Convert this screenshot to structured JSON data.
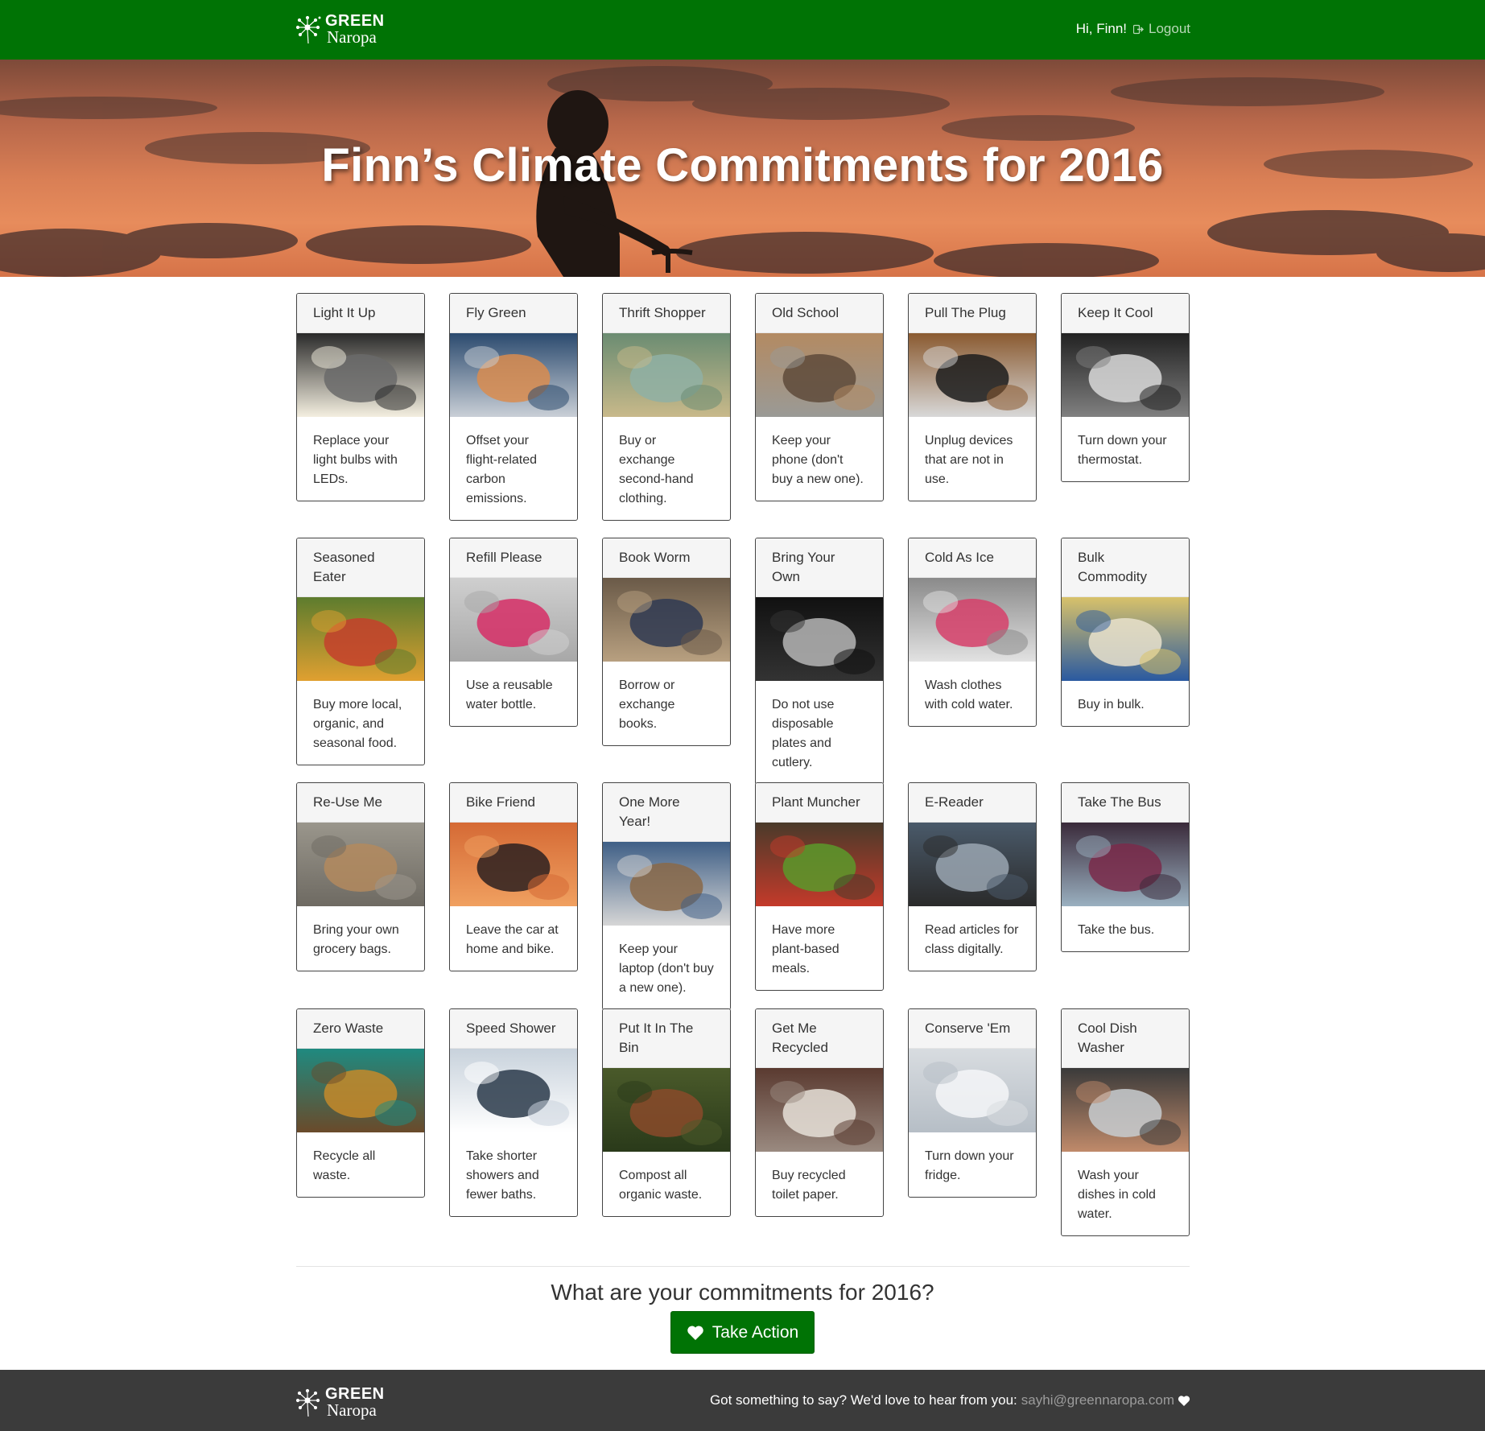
{
  "navbar": {
    "logo_top": "GREEN",
    "logo_bottom": "Naropa",
    "greeting": "Hi, Finn!",
    "logout": "Logout"
  },
  "hero": {
    "title": "Finn’s Climate Commitments for 2016"
  },
  "cards": [
    {
      "title": "Light It Up",
      "text": "Replace your light bulbs with LEDs.",
      "image": "led-bulbs"
    },
    {
      "title": "Fly Green",
      "text": "Offset your flight-related carbon emissions.",
      "image": "airplane-wing"
    },
    {
      "title": "Thrift Shopper",
      "text": "Buy or exchange second-hand clothing.",
      "image": "second-hand-sign"
    },
    {
      "title": "Old School",
      "text": "Keep your phone (don't buy a new one).",
      "image": "old-phone"
    },
    {
      "title": "Pull The Plug",
      "text": "Unplug devices that are not in use.",
      "image": "plug"
    },
    {
      "title": "Keep It Cool",
      "text": "Turn down your thermostat.",
      "image": "radiator"
    },
    {
      "title": "Seasoned Eater",
      "text": "Buy more local, organic, and seasonal food.",
      "image": "market"
    },
    {
      "title": "Refill Please",
      "text": "Use a reusable water bottle.",
      "image": "water-bottle"
    },
    {
      "title": "Book Worm",
      "text": "Borrow or exchange books.",
      "image": "bookstore"
    },
    {
      "title": "Bring Your Own",
      "text": "Do not use disposable plates and cutlery.",
      "image": "fork"
    },
    {
      "title": "Cold As Ice",
      "text": "Wash clothes with cold water.",
      "image": "washing-machine"
    },
    {
      "title": "Bulk Commodity",
      "text": "Buy in bulk.",
      "image": "rice-sacks"
    },
    {
      "title": "Re-Use Me",
      "text": "Bring your own grocery bags.",
      "image": "paper-bag"
    },
    {
      "title": "Bike Friend",
      "text": "Leave the car at home and bike.",
      "image": "cyclist"
    },
    {
      "title": "One More Year!",
      "text": "Keep your laptop (don't buy a new one).",
      "image": "laptop"
    },
    {
      "title": "Plant Muncher",
      "text": "Have more plant-based meals.",
      "image": "vegetable-basket"
    },
    {
      "title": "E-Reader",
      "text": "Read articles for class digitally.",
      "image": "e-reader"
    },
    {
      "title": "Take The Bus",
      "text": "Take the bus.",
      "image": "bus-interior"
    },
    {
      "title": "Zero Waste",
      "text": "Recycle all waste.",
      "image": "recycle-bag"
    },
    {
      "title": "Speed Shower",
      "text": "Take shorter showers and fewer baths.",
      "image": "shower-head"
    },
    {
      "title": "Put It In The Bin",
      "text": "Compost all organic waste.",
      "image": "compost"
    },
    {
      "title": "Get Me Recycled",
      "text": "Buy recycled toilet paper.",
      "image": "toilet-paper"
    },
    {
      "title": "Conserve 'Em",
      "text": "Turn down your fridge.",
      "image": "ice"
    },
    {
      "title": "Cool Dish Washer",
      "text": "Wash your dishes in cold water.",
      "image": "dishwashing"
    }
  ],
  "cta": {
    "question": "What are your commitments for 2016?",
    "button": "Take Action"
  },
  "footer": {
    "logo_top": "GREEN",
    "logo_bottom": "Naropa",
    "message": "Got something to say? We'd love to hear from you:",
    "email": "sayhi@greennaropa.com"
  },
  "colors": {
    "brand_green": "#007305",
    "footer_bg": "#3b3b3b"
  }
}
